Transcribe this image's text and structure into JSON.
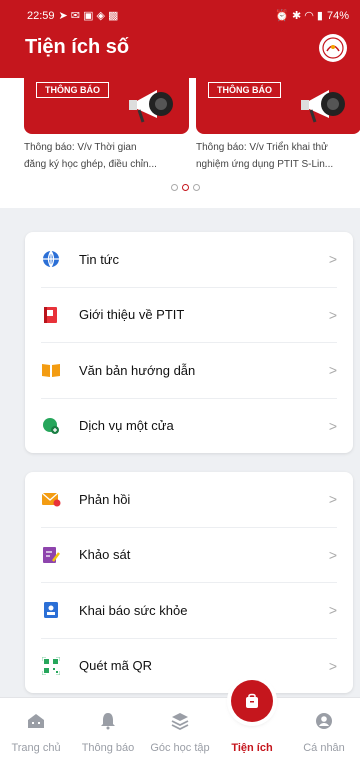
{
  "status_bar": {
    "time": "22:59",
    "battery": "74%"
  },
  "header": {
    "title": "Tiện ích số"
  },
  "carousel": {
    "cards": [
      {
        "badge": "THÔNG BÁO",
        "line1": "Thông báo: V/v Thời gian",
        "line2": "đăng ký học ghép, điều chỉn..."
      },
      {
        "badge": "THÔNG BÁO",
        "line1": "Thông báo: V/v Triển khai thử",
        "line2": "nghiệm ứng dụng PTIT S-Lin..."
      }
    ]
  },
  "menu1": [
    {
      "label": "Tin tức",
      "icon": "globe-icon"
    },
    {
      "label": "Giới thiệu về PTIT",
      "icon": "book-flag-icon"
    },
    {
      "label": "Văn bản hướng dẫn",
      "icon": "open-book-icon"
    },
    {
      "label": "Dịch vụ một cửa",
      "icon": "service-icon"
    }
  ],
  "menu2": [
    {
      "label": "Phản hồi",
      "icon": "feedback-mail-icon"
    },
    {
      "label": "Khảo sát",
      "icon": "survey-edit-icon"
    },
    {
      "label": "Khai báo sức khỏe",
      "icon": "health-id-icon"
    },
    {
      "label": "Quét mã QR",
      "icon": "qr-scan-icon"
    }
  ],
  "nav": [
    {
      "label": "Trang chủ",
      "icon": "home-icon"
    },
    {
      "label": "Thông báo",
      "icon": "bell-icon"
    },
    {
      "label": "Góc học tập",
      "icon": "layers-icon"
    },
    {
      "label": "Tiện ích",
      "icon": "bag-icon"
    },
    {
      "label": "Cá nhân",
      "icon": "person-icon"
    }
  ],
  "colors": {
    "brand": "#c5161d",
    "background": "#eef0f3"
  }
}
